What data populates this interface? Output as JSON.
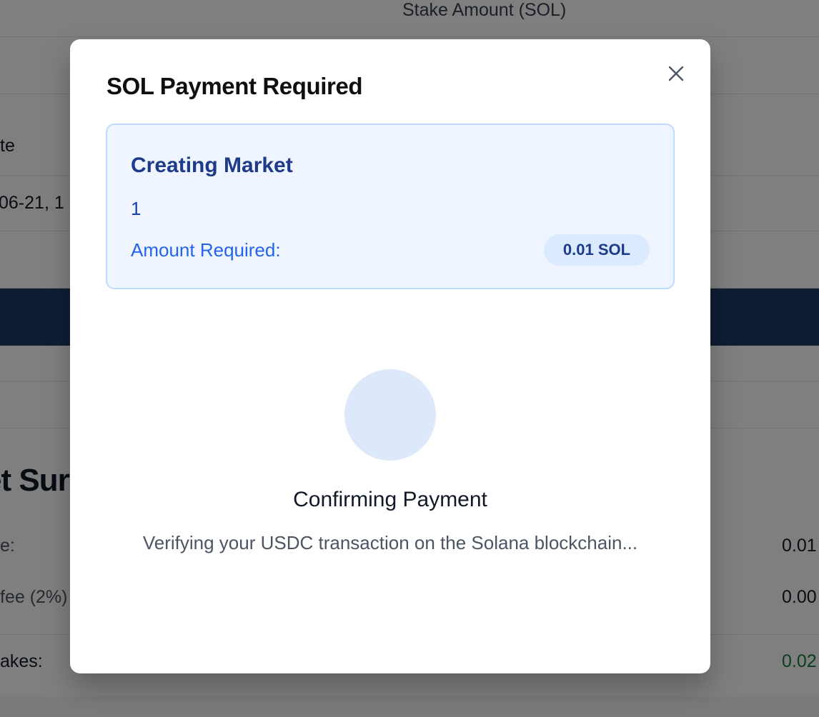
{
  "background": {
    "table_header": "Stake Amount (SOL)",
    "date_header_fragment": "te",
    "date_value_fragment": "06-21, 1",
    "summary_title_fragment": "et Sur",
    "summary_rows": [
      {
        "label_fragment": "e:",
        "value_fragment": "0.01"
      },
      {
        "label_fragment": "fee (2%)",
        "value_fragment": "0.00"
      },
      {
        "label_fragment": "akes:",
        "value_fragment": "0.02"
      }
    ]
  },
  "modal": {
    "title": "SOL Payment Required",
    "close_icon": "close-icon",
    "card": {
      "title": "Creating Market",
      "value": "1",
      "amount_label": "Amount Required:",
      "amount_badge": "0.01 SOL"
    },
    "status": {
      "title": "Confirming Payment",
      "description": "Verifying your USDC transaction on the Solana blockchain..."
    }
  },
  "colors": {
    "overlay": "rgba(0,0,0,0.5)",
    "card_bg": "#eef5fe",
    "card_border": "#bfdbfe",
    "accent_dark": "#1e3a8a",
    "accent": "#2563eb",
    "background_band": "#1e3a66"
  }
}
